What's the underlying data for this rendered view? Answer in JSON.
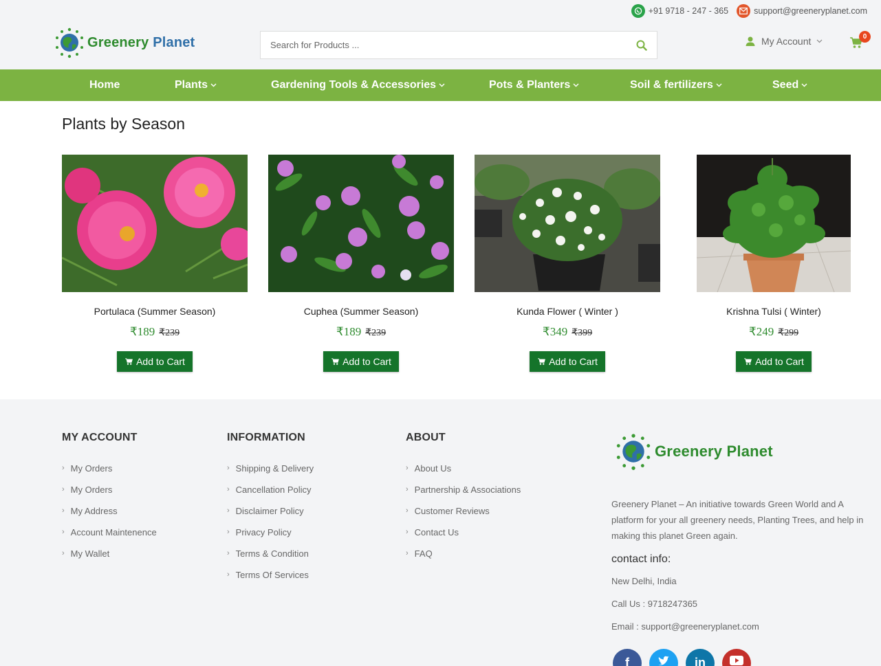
{
  "topbar": {
    "phone": "+91 9718 - 247 - 365",
    "email": "support@greeneryplanet.com"
  },
  "brand": {
    "name_part1": "Greenery",
    "name_part2": "Planet"
  },
  "search": {
    "placeholder": "Search for Products ..."
  },
  "account": {
    "label": "My Account"
  },
  "cart": {
    "count": "0"
  },
  "nav": {
    "items": [
      {
        "label": "Home"
      },
      {
        "label": "Plants"
      },
      {
        "label": "Gardening Tools & Accessories"
      },
      {
        "label": "Pots & Planters"
      },
      {
        "label": "Soil & fertilizers"
      },
      {
        "label": "Seed"
      }
    ]
  },
  "section": {
    "title": "Plants by Season"
  },
  "products": [
    {
      "name": "Portulaca (Summer Season)",
      "price": "₹189",
      "old_price": "₹239",
      "button": "Add to Cart"
    },
    {
      "name": "Cuphea (Summer Season)",
      "price": "₹189",
      "old_price": "₹239",
      "button": "Add to Cart"
    },
    {
      "name": "Kunda Flower ( Winter )",
      "price": "₹349",
      "old_price": "₹399",
      "button": "Add to Cart"
    },
    {
      "name": "Krishna Tulsi ( Winter)",
      "price": "₹249",
      "old_price": "₹299",
      "button": "Add to Cart"
    }
  ],
  "footer": {
    "my_account": {
      "title": "MY ACCOUNT",
      "links": [
        "My Orders",
        "My Orders",
        "My Address",
        "Account Maintenence",
        "My Wallet"
      ]
    },
    "information": {
      "title": "INFORMATION",
      "links": [
        "Shipping & Delivery",
        "Cancellation Policy",
        "Disclaimer Policy",
        "Privacy Policy",
        "Terms & Condition",
        "Terms Of Services"
      ]
    },
    "about": {
      "title": "ABOUT",
      "links": [
        "About Us",
        "Partnership & Associations",
        "Customer Reviews",
        "Contact Us",
        "FAQ"
      ]
    },
    "description": "Greenery Planet – An initiative towards Green World and A platform for your all greenery needs, Planting Trees, and help in making this planet Green again.",
    "contact_title": "contact info:",
    "address": "New Delhi, India",
    "call": "Call Us : 9718247365",
    "email": "Email : support@greeneryplanet.com"
  },
  "colors": {
    "nav_green": "#7cb342",
    "button_green": "#15742a",
    "price_green": "#2e8b2e",
    "badge": "#e8461e"
  }
}
